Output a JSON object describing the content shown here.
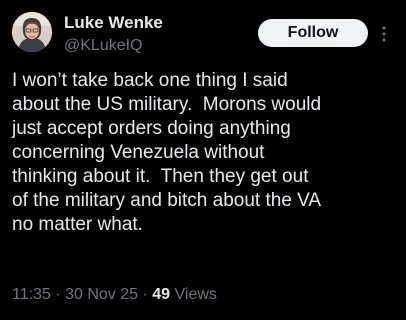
{
  "author": {
    "display_name": "Luke Wenke",
    "handle": "@KLukeIQ"
  },
  "follow_button_label": "Follow",
  "tweet_text_lines": [
    "I won’t take back one thing I said",
    "about the US military.  Morons would",
    "just accept orders doing anything",
    "concerning Venezuela without",
    "thinking about it.  Then they get out",
    "of the military and bitch about the VA",
    "no matter what."
  ],
  "meta": {
    "time": "11:35",
    "separator": "·",
    "date": "30 Nov 25",
    "views_count": "49",
    "views_label": "Views"
  },
  "colors": {
    "background": "#000000",
    "primary_text": "#e7e9ea",
    "secondary_text": "#71767b",
    "follow_bg": "#eff3f4",
    "follow_text": "#0f1419"
  },
  "icons": {
    "more": "more-icon"
  }
}
